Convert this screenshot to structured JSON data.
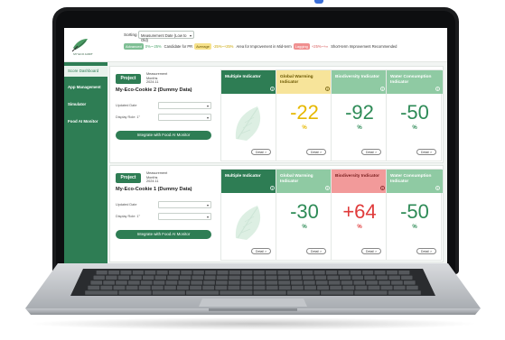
{
  "app": {
    "logo_text": "MY ECO AUDIT"
  },
  "topbar": {
    "sort_label": "Sorting",
    "sort_value": "Measurement Date (Low to Old)",
    "legend": {
      "advanced_label": "Advanced",
      "advanced_range": "0%~-25%",
      "advanced_text": "Candidate for PR",
      "average_label": "Average",
      "average_range": "-25%~+25%",
      "average_text": "Area for Improvement in Mid-term",
      "lagging_label": "Lagging",
      "lagging_range": "+25%~+∞",
      "lagging_text": "Short-term Improvement Recommended"
    }
  },
  "sidebar": {
    "items": [
      {
        "label": "Score Dashboard",
        "active": true
      },
      {
        "label": "App Management",
        "active": false
      },
      {
        "label": "Simulator",
        "active": false
      },
      {
        "label": "Food AI Monitor",
        "active": false
      }
    ]
  },
  "cards": [
    {
      "project_label": "Project",
      "measurement": [
        "Measurement",
        "Months",
        "2024.11"
      ],
      "name": "My-Eco-Cookie 2 (Dummy Data)",
      "updated_label": "Updated Date",
      "display_label": "Display Role: 1°",
      "integrate_label": "Integrate with Food AI Monitor",
      "indicators": [
        {
          "title": "Multiple Indicator",
          "value": "",
          "style": "green",
          "color": "g"
        },
        {
          "title": "Global Warming Indicator",
          "value": "-22",
          "style": "yellow",
          "color": "y"
        },
        {
          "title": "Biodiversity Indicator",
          "value": "-92",
          "style": "mint",
          "color": "g"
        },
        {
          "title": "Water Consumption Indicator",
          "value": "-50",
          "style": "mint",
          "color": "g"
        }
      ]
    },
    {
      "project_label": "Project",
      "measurement": [
        "Measurement",
        "Months",
        "2024.11"
      ],
      "name": "My-Eco-Cookie 1 (Dummy Data)",
      "updated_label": "Updated Date",
      "display_label": "Display Role: 1°",
      "integrate_label": "Integrate with Food AI Monitor",
      "indicators": [
        {
          "title": "Multiple Indicator",
          "value": "",
          "style": "green",
          "color": "g"
        },
        {
          "title": "Global Warming Indicator",
          "value": "-30",
          "style": "mint",
          "color": "g"
        },
        {
          "title": "Biodiversity Indicator",
          "value": "+64",
          "style": "red",
          "color": "r"
        },
        {
          "title": "Water Consumption Indicator",
          "value": "-50",
          "style": "mint",
          "color": "g"
        }
      ]
    }
  ],
  "common": {
    "percent": "%",
    "detail_label": "Detail >",
    "info_glyph": "i"
  },
  "colors": {
    "brand_green": "#2e7d54",
    "advanced": "#7fbf95",
    "average": "#f6e18a",
    "lagging": "#f08f8f"
  }
}
